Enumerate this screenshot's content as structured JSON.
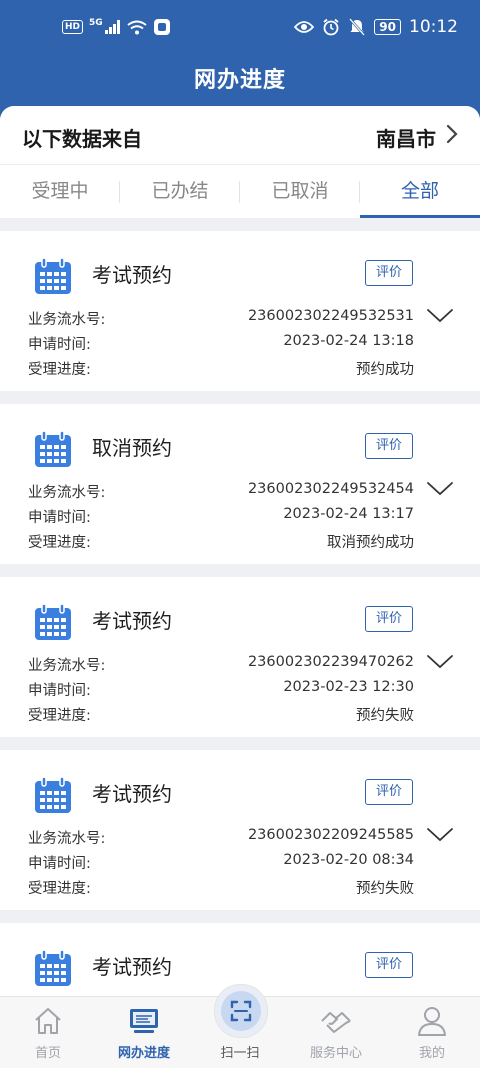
{
  "status_bar": {
    "hd": "HD",
    "net": "5G",
    "battery": "90",
    "time": "10:12",
    "icons": [
      "signal-icon",
      "wifi-icon",
      "app-notification-icon",
      "eye-icon",
      "alarm-icon",
      "mute-icon"
    ]
  },
  "header": {
    "title": "网办进度"
  },
  "source": {
    "label": "以下数据来自",
    "city": "南昌市"
  },
  "tabs": [
    {
      "label": "受理中",
      "active": false
    },
    {
      "label": "已办结",
      "active": false
    },
    {
      "label": "已取消",
      "active": false
    },
    {
      "label": "全部",
      "active": true
    }
  ],
  "items": [
    {
      "title": "考试预约",
      "rate_label": "评价",
      "serial_label": "业务流水号:",
      "serial": "236002302249532531",
      "time_label": "申请时间:",
      "time": "2023-02-24 13:18",
      "progress_label": "受理进度:",
      "progress": "预约成功"
    },
    {
      "title": "取消预约",
      "rate_label": "评价",
      "serial_label": "业务流水号:",
      "serial": "236002302249532454",
      "time_label": "申请时间:",
      "time": "2023-02-24 13:17",
      "progress_label": "受理进度:",
      "progress": "取消预约成功"
    },
    {
      "title": "考试预约",
      "rate_label": "评价",
      "serial_label": "业务流水号:",
      "serial": "236002302239470262",
      "time_label": "申请时间:",
      "time": "2023-02-23 12:30",
      "progress_label": "受理进度:",
      "progress": "预约失败"
    },
    {
      "title": "考试预约",
      "rate_label": "评价",
      "serial_label": "业务流水号:",
      "serial": "236002302209245585",
      "time_label": "申请时间:",
      "time": "2023-02-20 08:34",
      "progress_label": "受理进度:",
      "progress": "预约失败"
    },
    {
      "title": "考试预约",
      "rate_label": "评价"
    }
  ],
  "nav": [
    {
      "label": "首页",
      "icon": "home-icon",
      "active": false
    },
    {
      "label": "网办进度",
      "icon": "monitor-icon",
      "active": true
    },
    {
      "label": "扫一扫",
      "icon": "scan-icon",
      "active": false
    },
    {
      "label": "服务中心",
      "icon": "handshake-icon",
      "active": false
    },
    {
      "label": "我的",
      "icon": "user-icon",
      "active": false
    }
  ],
  "colors": {
    "brand": "#2f63ad",
    "background": "#eef0f3",
    "muted": "#a0a4aa"
  }
}
